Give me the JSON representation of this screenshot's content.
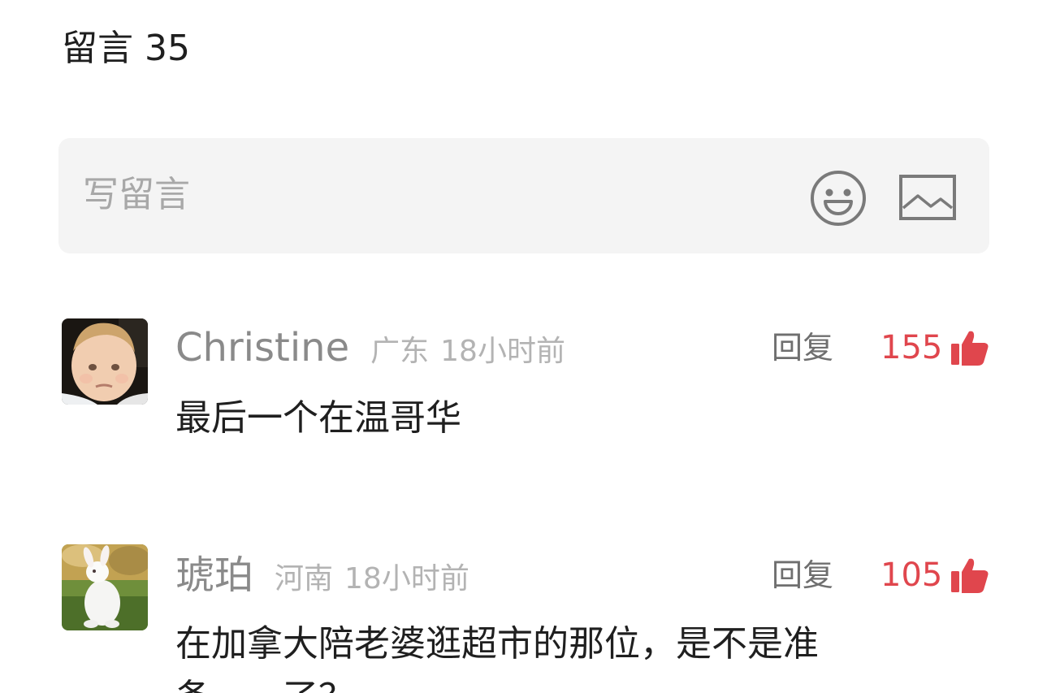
{
  "comments_section": {
    "title": "留言 35",
    "input": {
      "placeholder": "写留言",
      "emoji_icon": "smiley-face-icon",
      "image_icon": "image-icon"
    }
  },
  "comments": [
    {
      "username": "Christine",
      "location": "广东",
      "time": "18小时前",
      "reply_label": "回复",
      "likes": "155",
      "like_icon": "thumbs-up-icon",
      "avatar": "baby-photo-avatar",
      "text_lines": [
        "最后一个在温哥华"
      ]
    },
    {
      "username": "琥珀",
      "location": "河南",
      "time": "18小时前",
      "reply_label": "回复",
      "likes": "105",
      "like_icon": "thumbs-up-icon",
      "avatar": "white-rabbit-photo-avatar",
      "text_lines": [
        "在加拿大陪老婆逛超市的那位，是不是准",
        "备……了？"
      ]
    }
  ],
  "colors": {
    "like_accent": "#e0464d",
    "input_background": "#f4f4f4",
    "muted_text": "#a8a8a8"
  }
}
